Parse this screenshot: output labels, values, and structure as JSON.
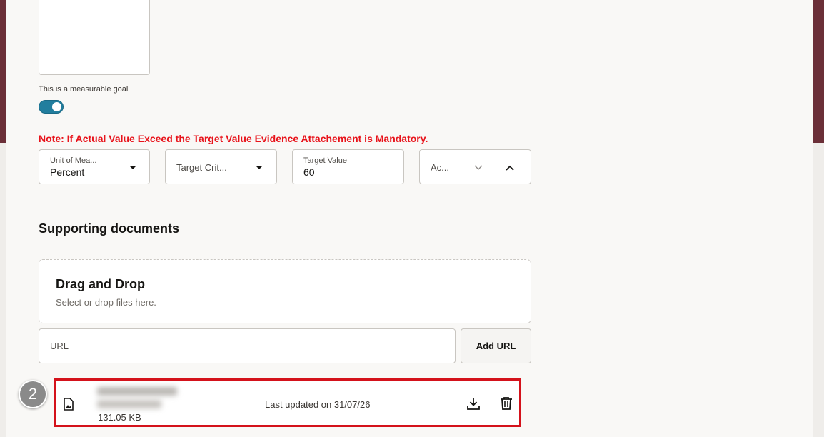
{
  "goal": {
    "measurable_label": "This is a measurable goal",
    "measurable_enabled": true
  },
  "note": "Note: If Actual Value Exceed the Target Value Evidence Attachement is Mandatory.",
  "fields": {
    "unit_of_measure": {
      "label": "Unit of Mea...",
      "value": "Percent"
    },
    "target_criteria": {
      "label": "Target Crit..."
    },
    "target_value": {
      "label": "Target Value",
      "value": "60"
    },
    "actual": {
      "label": "Ac..."
    }
  },
  "supporting_documents": {
    "title": "Supporting documents",
    "dropzone": {
      "title": "Drag and Drop",
      "subtitle": "Select or drop files here."
    },
    "url_placeholder": "URL",
    "add_url_label": "Add URL",
    "file": {
      "size": "131.05 KB",
      "updated": "Last updated on 31/07/26"
    }
  },
  "step_badge": "2",
  "colors": {
    "toggle_on": "#227e9e",
    "note": "#e8131b",
    "highlight_border": "#d4121b",
    "header_band": "#6b2f38"
  }
}
